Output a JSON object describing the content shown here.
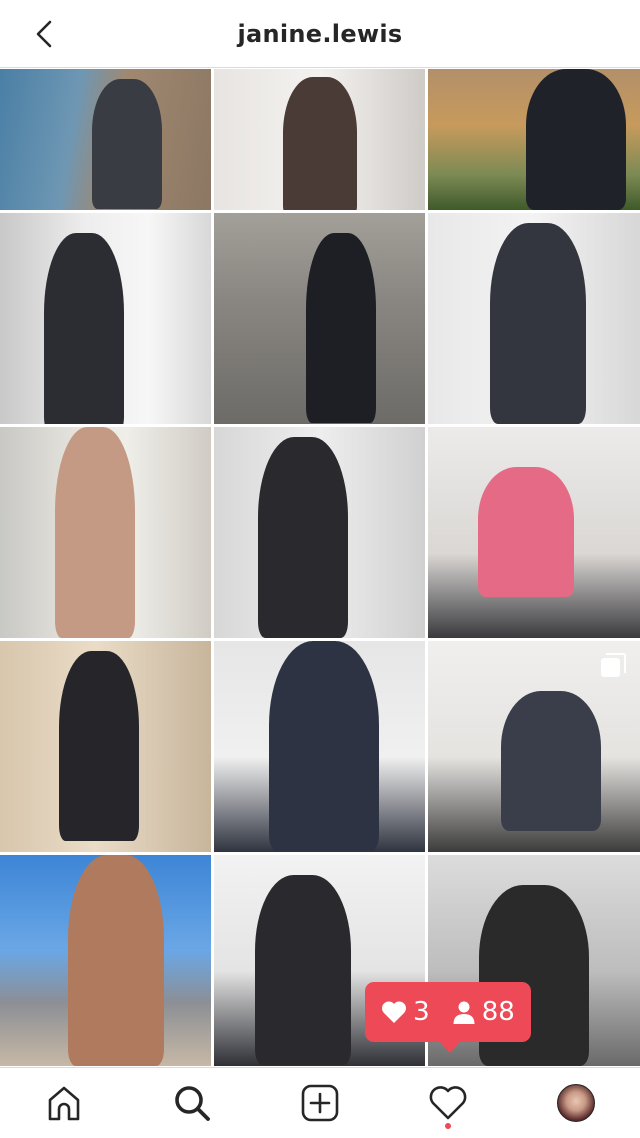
{
  "header": {
    "title": "janine.lewis",
    "back_icon": "chevron-left-icon"
  },
  "grid": {
    "tiles": [
      {
        "id": 1,
        "multiple": false
      },
      {
        "id": 2,
        "multiple": false
      },
      {
        "id": 3,
        "multiple": false
      },
      {
        "id": 4,
        "multiple": false
      },
      {
        "id": 5,
        "multiple": false
      },
      {
        "id": 6,
        "multiple": false
      },
      {
        "id": 7,
        "multiple": false
      },
      {
        "id": 8,
        "multiple": false
      },
      {
        "id": 9,
        "multiple": false
      },
      {
        "id": 10,
        "multiple": false
      },
      {
        "id": 11,
        "multiple": false
      },
      {
        "id": 12,
        "multiple": true
      },
      {
        "id": 13,
        "multiple": false
      },
      {
        "id": 14,
        "multiple": false
      },
      {
        "id": 15,
        "multiple": false
      }
    ]
  },
  "activity_popup": {
    "likes_count": "3",
    "followers_count": "88",
    "likes_icon": "heart-icon",
    "followers_icon": "person-icon",
    "color": "#ed4956"
  },
  "tabbar": {
    "items": [
      {
        "name": "home",
        "icon": "home-icon"
      },
      {
        "name": "search",
        "icon": "search-icon",
        "active": true
      },
      {
        "name": "new-post",
        "icon": "plus-square-icon"
      },
      {
        "name": "activity",
        "icon": "heart-outline-icon",
        "notification_dot": true
      },
      {
        "name": "profile",
        "icon": "avatar"
      }
    ]
  }
}
